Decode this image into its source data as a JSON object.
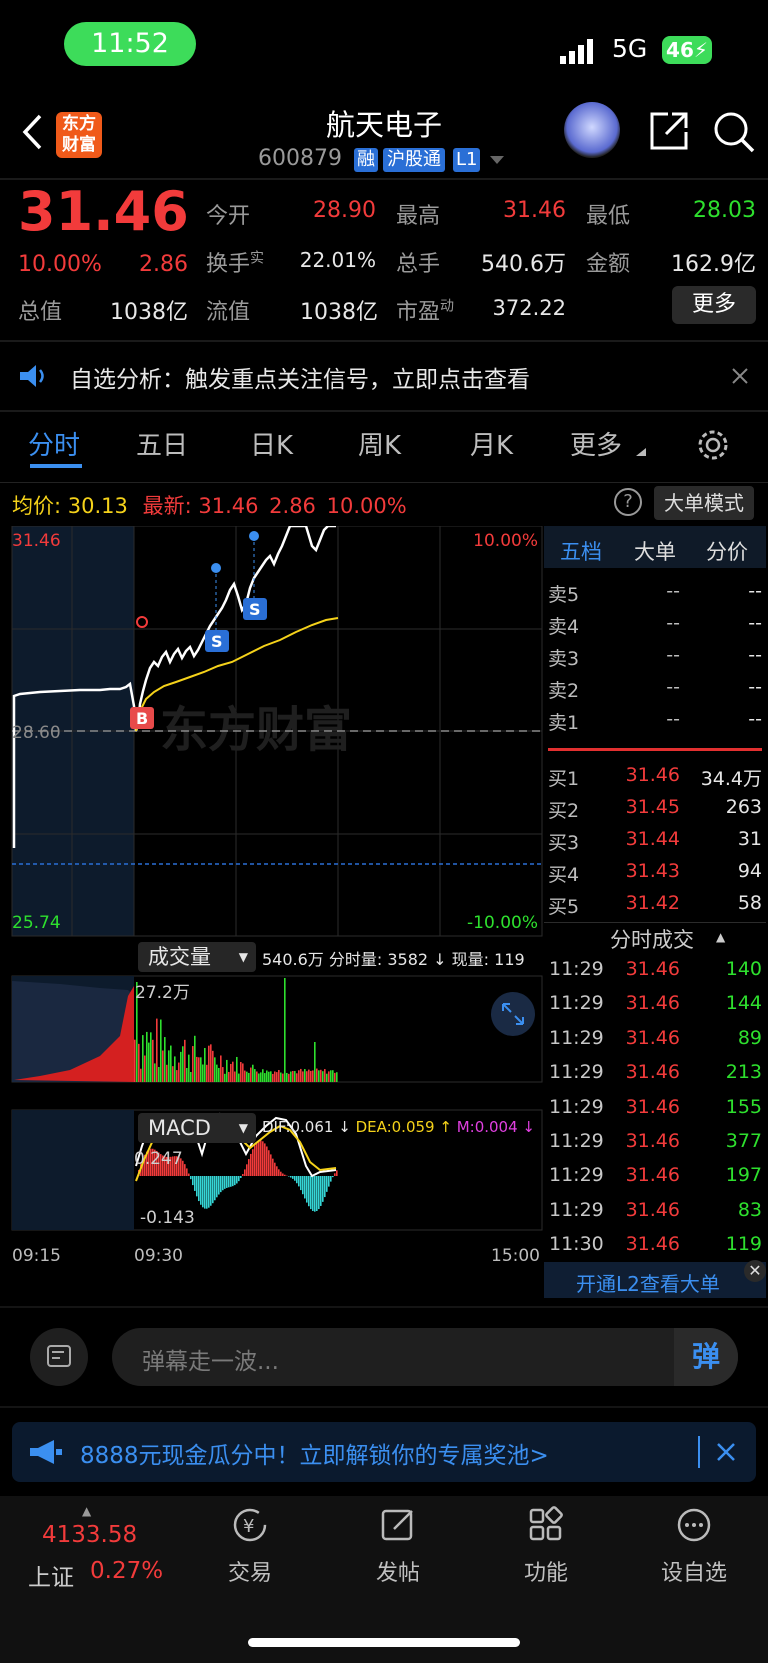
{
  "status": {
    "time": "11:52",
    "network": "5G",
    "battery": "46"
  },
  "header": {
    "back_icon": "chevron-left-icon",
    "logo_text": "东方财富",
    "title": "航天电子",
    "code": "600879",
    "tags": [
      "融",
      "沪股通",
      "L1"
    ]
  },
  "quote": {
    "price": "31.46",
    "pct": "10.00%",
    "chg": "2.86",
    "open_label": "今开",
    "open": "28.90",
    "high_label": "最高",
    "high": "31.46",
    "low_label": "最低",
    "low": "28.03",
    "turnover_label": "换手",
    "turnover_sup": "实",
    "turnover": "22.01%",
    "volume_label": "总手",
    "volume": "540.6万",
    "amount_label": "金额",
    "amount": "162.9亿",
    "mktcap_label": "总值",
    "mktcap": "1038亿",
    "float_label": "流值",
    "float": "1038亿",
    "pe_label": "市盈",
    "pe_sup": "动",
    "pe": "372.22",
    "more": "更多"
  },
  "notice": {
    "text": "自选分析：触发重点关注信号，立即点击查看"
  },
  "tabs": [
    "分时",
    "五日",
    "日K",
    "周K",
    "月K",
    "更多"
  ],
  "chart_info": {
    "avg_label": "均价:",
    "avg": "30.13",
    "latest_label": "最新:",
    "latest": "31.46",
    "chg": "2.86",
    "pct": "10.00%",
    "big_order_mode": "大单模式"
  },
  "chart_labels": {
    "ymax": "31.46",
    "pmax": "10.00%",
    "prev_close": "28.60",
    "ymin": "25.74",
    "pmin": "-10.00%",
    "watermark": "东方财富"
  },
  "volume_bar": {
    "selector": "成交量",
    "stats": "540.6万 分时量: 3582 ↓ 现量: 119",
    "peak": "27.2万"
  },
  "macd_bar": {
    "selector": "MACD",
    "dif": "DIF:0.061 ↓",
    "dea": "DEA:0.059 ↑",
    "m": "M:0.004 ↓",
    "top": "0.247",
    "bottom": "-0.143"
  },
  "time_axis": {
    "start": "09:15",
    "open": "09:30",
    "close": "15:00"
  },
  "orderbook": {
    "tabs": [
      "五档",
      "大单",
      "分价"
    ],
    "sells": [
      {
        "l": "卖5",
        "p": "--",
        "v": "--"
      },
      {
        "l": "卖4",
        "p": "--",
        "v": "--"
      },
      {
        "l": "卖3",
        "p": "--",
        "v": "--"
      },
      {
        "l": "卖2",
        "p": "--",
        "v": "--"
      },
      {
        "l": "卖1",
        "p": "--",
        "v": "--"
      }
    ],
    "buys": [
      {
        "l": "买1",
        "p": "31.46",
        "v": "34.4万"
      },
      {
        "l": "买2",
        "p": "31.45",
        "v": "263"
      },
      {
        "l": "买3",
        "p": "31.44",
        "v": "31"
      },
      {
        "l": "买4",
        "p": "31.43",
        "v": "94"
      },
      {
        "l": "买5",
        "p": "31.42",
        "v": "58"
      }
    ]
  },
  "ticks": {
    "title": "分时成交",
    "rows": [
      {
        "t": "11:29",
        "p": "31.46",
        "v": "140",
        "c": "green"
      },
      {
        "t": "11:29",
        "p": "31.46",
        "v": "144",
        "c": "green"
      },
      {
        "t": "11:29",
        "p": "31.46",
        "v": "89",
        "c": "green"
      },
      {
        "t": "11:29",
        "p": "31.46",
        "v": "213",
        "c": "green"
      },
      {
        "t": "11:29",
        "p": "31.46",
        "v": "155",
        "c": "green"
      },
      {
        "t": "11:29",
        "p": "31.46",
        "v": "377",
        "c": "green"
      },
      {
        "t": "11:29",
        "p": "31.46",
        "v": "197",
        "c": "green"
      },
      {
        "t": "11:29",
        "p": "31.46",
        "v": "83",
        "c": "green"
      },
      {
        "t": "11:30",
        "p": "31.46",
        "v": "119",
        "c": "green"
      }
    ],
    "l2": "开通L2查看大单"
  },
  "comment": {
    "placeholder": "弹幕走一波...",
    "danmu": "弹"
  },
  "promo": {
    "text": "8888元现金瓜分中！立即解锁你的专属奖池>"
  },
  "bottom_nav": {
    "index_value": "4133.58",
    "index_name": "上证",
    "index_pct": "0.27%",
    "items": [
      "交易",
      "发帖",
      "功能",
      "设自选"
    ]
  },
  "colors": {
    "up": "#f23b3b",
    "down": "#2ee02e",
    "avg_line": "#f5d21a",
    "accent": "#2f8ef0"
  }
}
